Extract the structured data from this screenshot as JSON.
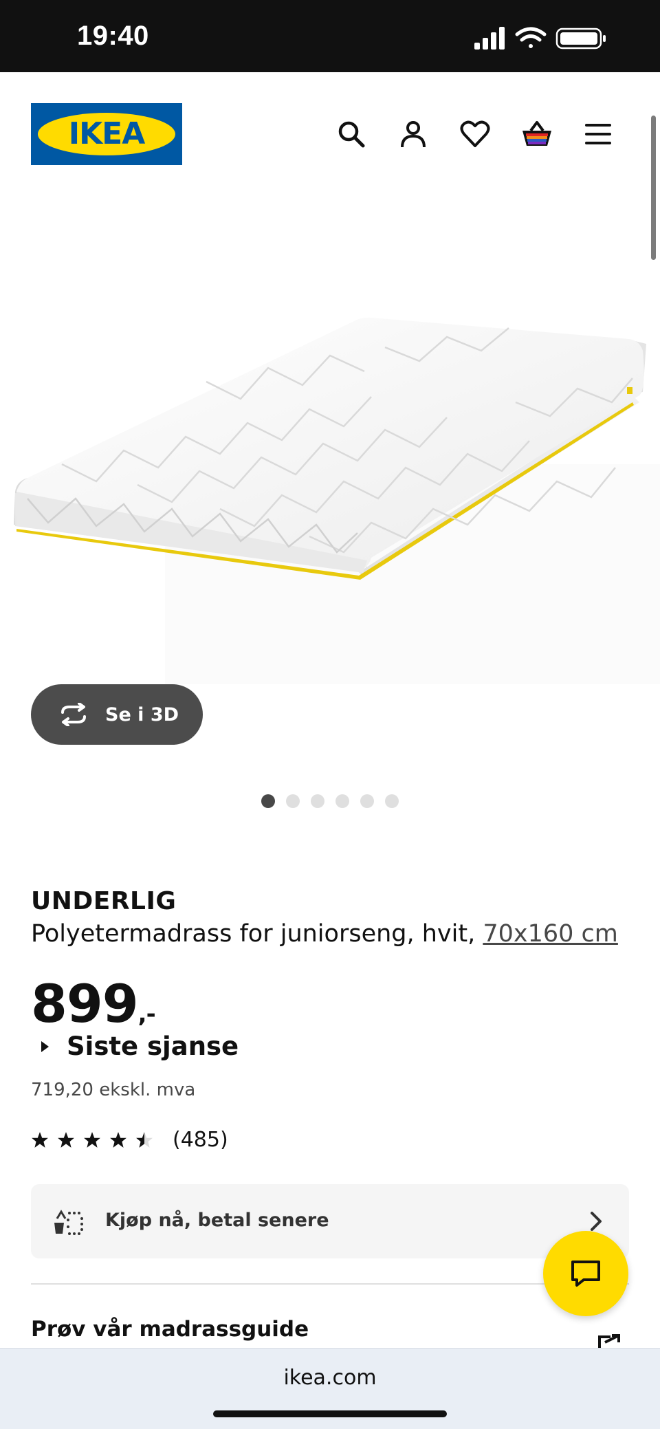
{
  "status_bar": {
    "time": "19:40"
  },
  "header": {
    "logo_text": "IKEA"
  },
  "product": {
    "view_3d_label": "Se i 3D",
    "image_count": 6,
    "active_image": 1,
    "name": "UNDERLIG",
    "description": "Polyetermadrass for juniorseng, hvit, ",
    "size": "70x160 cm",
    "price": "899",
    "price_suffix": ",-",
    "offer_label": "Siste sjanse",
    "price_ex_vat": "719,20 ekskl. mva",
    "rating_value": 4.5,
    "rating_max": 5,
    "rating_count": "(485)"
  },
  "bnpl": {
    "label": "Kjøp nå, betal senere"
  },
  "guide": {
    "title": "Prøv vår madrassguide"
  },
  "browser": {
    "url": "ikea.com"
  },
  "colors": {
    "brand_blue": "#0058a3",
    "brand_yellow": "#ffdb00",
    "dark_button": "#4c4c4c"
  },
  "icons": {
    "nav": [
      "search-icon",
      "account-icon",
      "heart-icon",
      "basket-icon",
      "menu-icon"
    ],
    "view_3d": "rotate-360-icon",
    "bnpl": "klarna-split-icon",
    "bnpl_action": "chevron-right-icon",
    "guide_action": "external-link-icon",
    "chat": "chat-icon"
  }
}
